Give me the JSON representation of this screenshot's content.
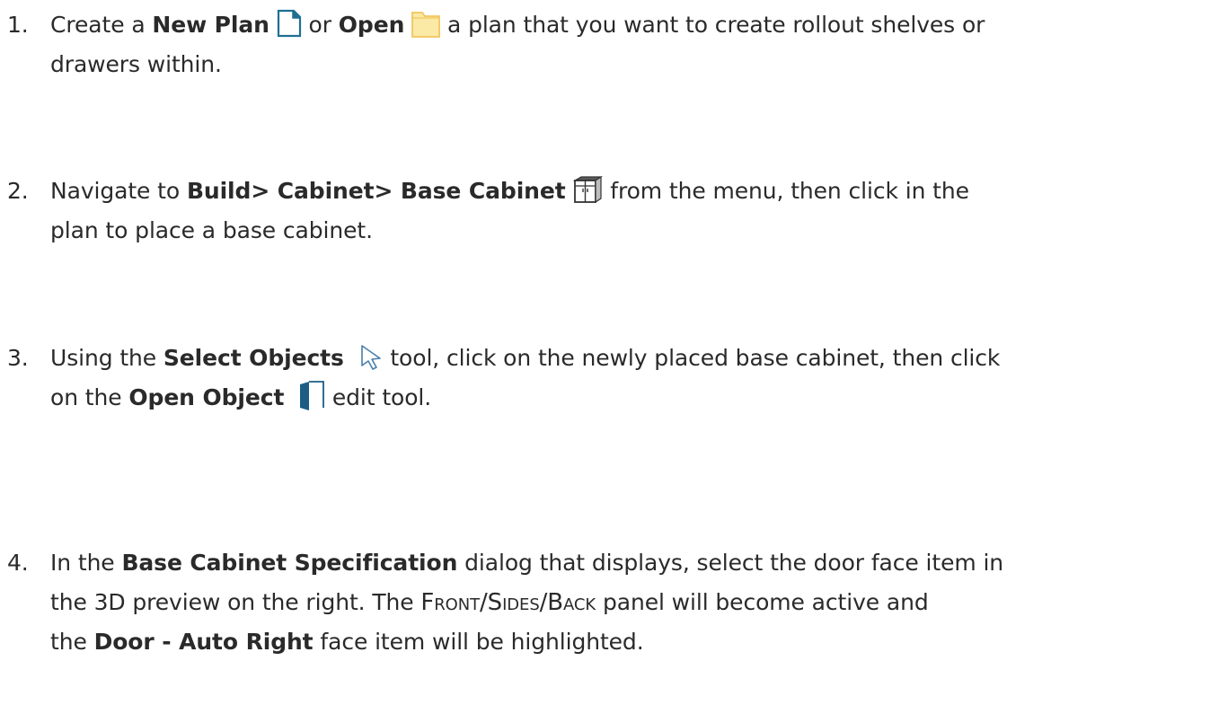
{
  "steps": [
    {
      "number": "1.",
      "parts": {
        "t1": "Create a ",
        "b1": "New Plan",
        "t2": " or ",
        "b2": "Open",
        "t3": " a plan that you want to create rollout shelves or",
        "t4": "drawers within."
      },
      "icons": [
        "new-plan-icon",
        "open-folder-icon"
      ]
    },
    {
      "number": "2.",
      "parts": {
        "t1": "Navigate to ",
        "b1": "Build> Cabinet> Base Cabinet",
        "t2": " from the menu, then click in the",
        "t3": "plan to place a base cabinet."
      },
      "icons": [
        "base-cabinet-icon"
      ]
    },
    {
      "number": "3.",
      "parts": {
        "t1": "Using the ",
        "b1": "Select Objects",
        "t2": " tool, click on the newly placed base cabinet, then click",
        "t3": "on the ",
        "b2": "Open Object",
        "t4": " edit tool."
      },
      "icons": [
        "select-objects-icon",
        "open-object-icon"
      ]
    },
    {
      "number": "4.",
      "parts": {
        "t1": "In the ",
        "b1": "Base Cabinet Specification",
        "t2": " dialog that displays, select the door face item in",
        "t3": "the 3D preview on the right. The ",
        "sc1": "Front/Sides/Back",
        "t4": " panel will become active and",
        "t5": "the ",
        "b2": "Door - Auto Right",
        "t6": " face item will be highlighted."
      }
    }
  ]
}
